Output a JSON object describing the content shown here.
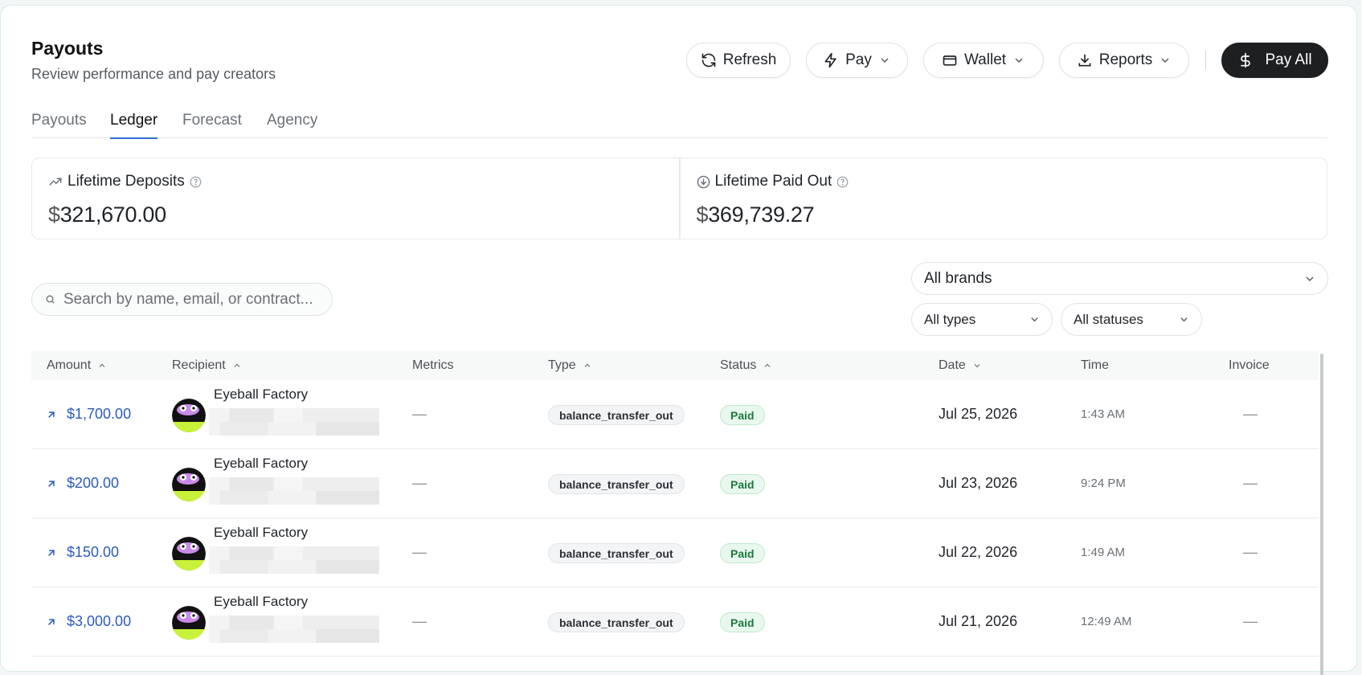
{
  "header": {
    "title": "Payouts",
    "subtitle": "Review performance and pay creators"
  },
  "toolbar": {
    "refresh_label": "Refresh",
    "pay_label": "Pay",
    "wallet_label": "Wallet",
    "reports_label": "Reports",
    "pay_all_label": "Pay All"
  },
  "tabs": [
    {
      "label": "Payouts",
      "active": false
    },
    {
      "label": "Ledger",
      "active": true
    },
    {
      "label": "Forecast",
      "active": false
    },
    {
      "label": "Agency",
      "active": false
    }
  ],
  "stats": {
    "deposits": {
      "label": "Lifetime Deposits",
      "currency": "$",
      "amount": "321,670.00"
    },
    "paid_out": {
      "label": "Lifetime Paid Out",
      "currency": "$",
      "amount": "369,739.27"
    }
  },
  "filters": {
    "search_placeholder": "Search by name, email, or contract...",
    "brand": "All brands",
    "type": "All types",
    "status": "All statuses"
  },
  "table": {
    "columns": [
      "Amount",
      "Recipient",
      "Metrics",
      "Type",
      "Status",
      "Date",
      "Time",
      "Invoice"
    ],
    "rows": [
      {
        "amount": "$1,700.00",
        "recipient": "Eyeball Factory",
        "metrics": "—",
        "type": "balance_transfer_out",
        "status": "Paid",
        "date": "Jul 25, 2026",
        "time": "1:43 AM",
        "invoice": "—"
      },
      {
        "amount": "$200.00",
        "recipient": "Eyeball Factory",
        "metrics": "—",
        "type": "balance_transfer_out",
        "status": "Paid",
        "date": "Jul 23, 2026",
        "time": "9:24 PM",
        "invoice": "—"
      },
      {
        "amount": "$150.00",
        "recipient": "Eyeball Factory",
        "metrics": "—",
        "type": "balance_transfer_out",
        "status": "Paid",
        "date": "Jul 22, 2026",
        "time": "1:49 AM",
        "invoice": "—"
      },
      {
        "amount": "$3,000.00",
        "recipient": "Eyeball Factory",
        "metrics": "—",
        "type": "balance_transfer_out",
        "status": "Paid",
        "date": "Jul 21, 2026",
        "time": "12:49 AM",
        "invoice": "—"
      }
    ]
  },
  "colors": {
    "accent_blue": "#2f6fd6",
    "amount_blue": "#2b5bbf",
    "paid_green": "#1b7a3d",
    "dark_button": "#1e1f21"
  },
  "icons": [
    "refresh-icon",
    "lightning-icon",
    "wallet-icon",
    "download-icon",
    "dollar-icon",
    "chevron-down-icon",
    "trending-up-icon",
    "arrow-down-circle-icon",
    "help-icon",
    "search-icon",
    "arrow-up-right-icon",
    "chevron-up-icon"
  ]
}
